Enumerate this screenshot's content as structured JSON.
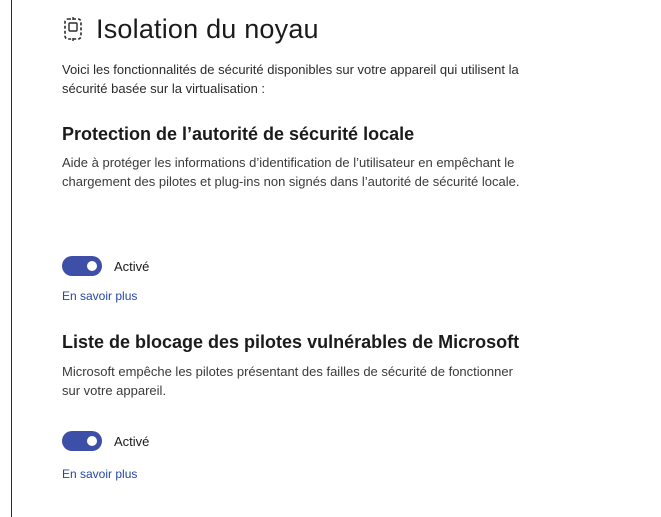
{
  "page": {
    "title": "Isolation du noyau",
    "icon": "chip-icon",
    "intro": "Voici les fonctionnalités de sécurité disponibles sur votre appareil qui utilisent la sécurité basée sur la virtualisation :"
  },
  "sections": [
    {
      "title": "Protection de l’autorité de sécurité locale",
      "description": "Aide à protéger les informations d’identification de l’utilisateur en empêchant le chargement des pilotes et plug-ins non signés dans l’autorité de sécurité locale.",
      "toggle_state": "on",
      "toggle_label": "Activé",
      "link": "En savoir plus"
    },
    {
      "title": "Liste de blocage des pilotes vulnérables de Microsoft",
      "description": "Microsoft empêche les pilotes présentant des failles de sécurité de fonctionner sur votre appareil.",
      "toggle_state": "on",
      "toggle_label": "Activé",
      "link": "En savoir plus"
    }
  ],
  "colors": {
    "accent": "#3d4fa6",
    "link": "#2546a8"
  }
}
